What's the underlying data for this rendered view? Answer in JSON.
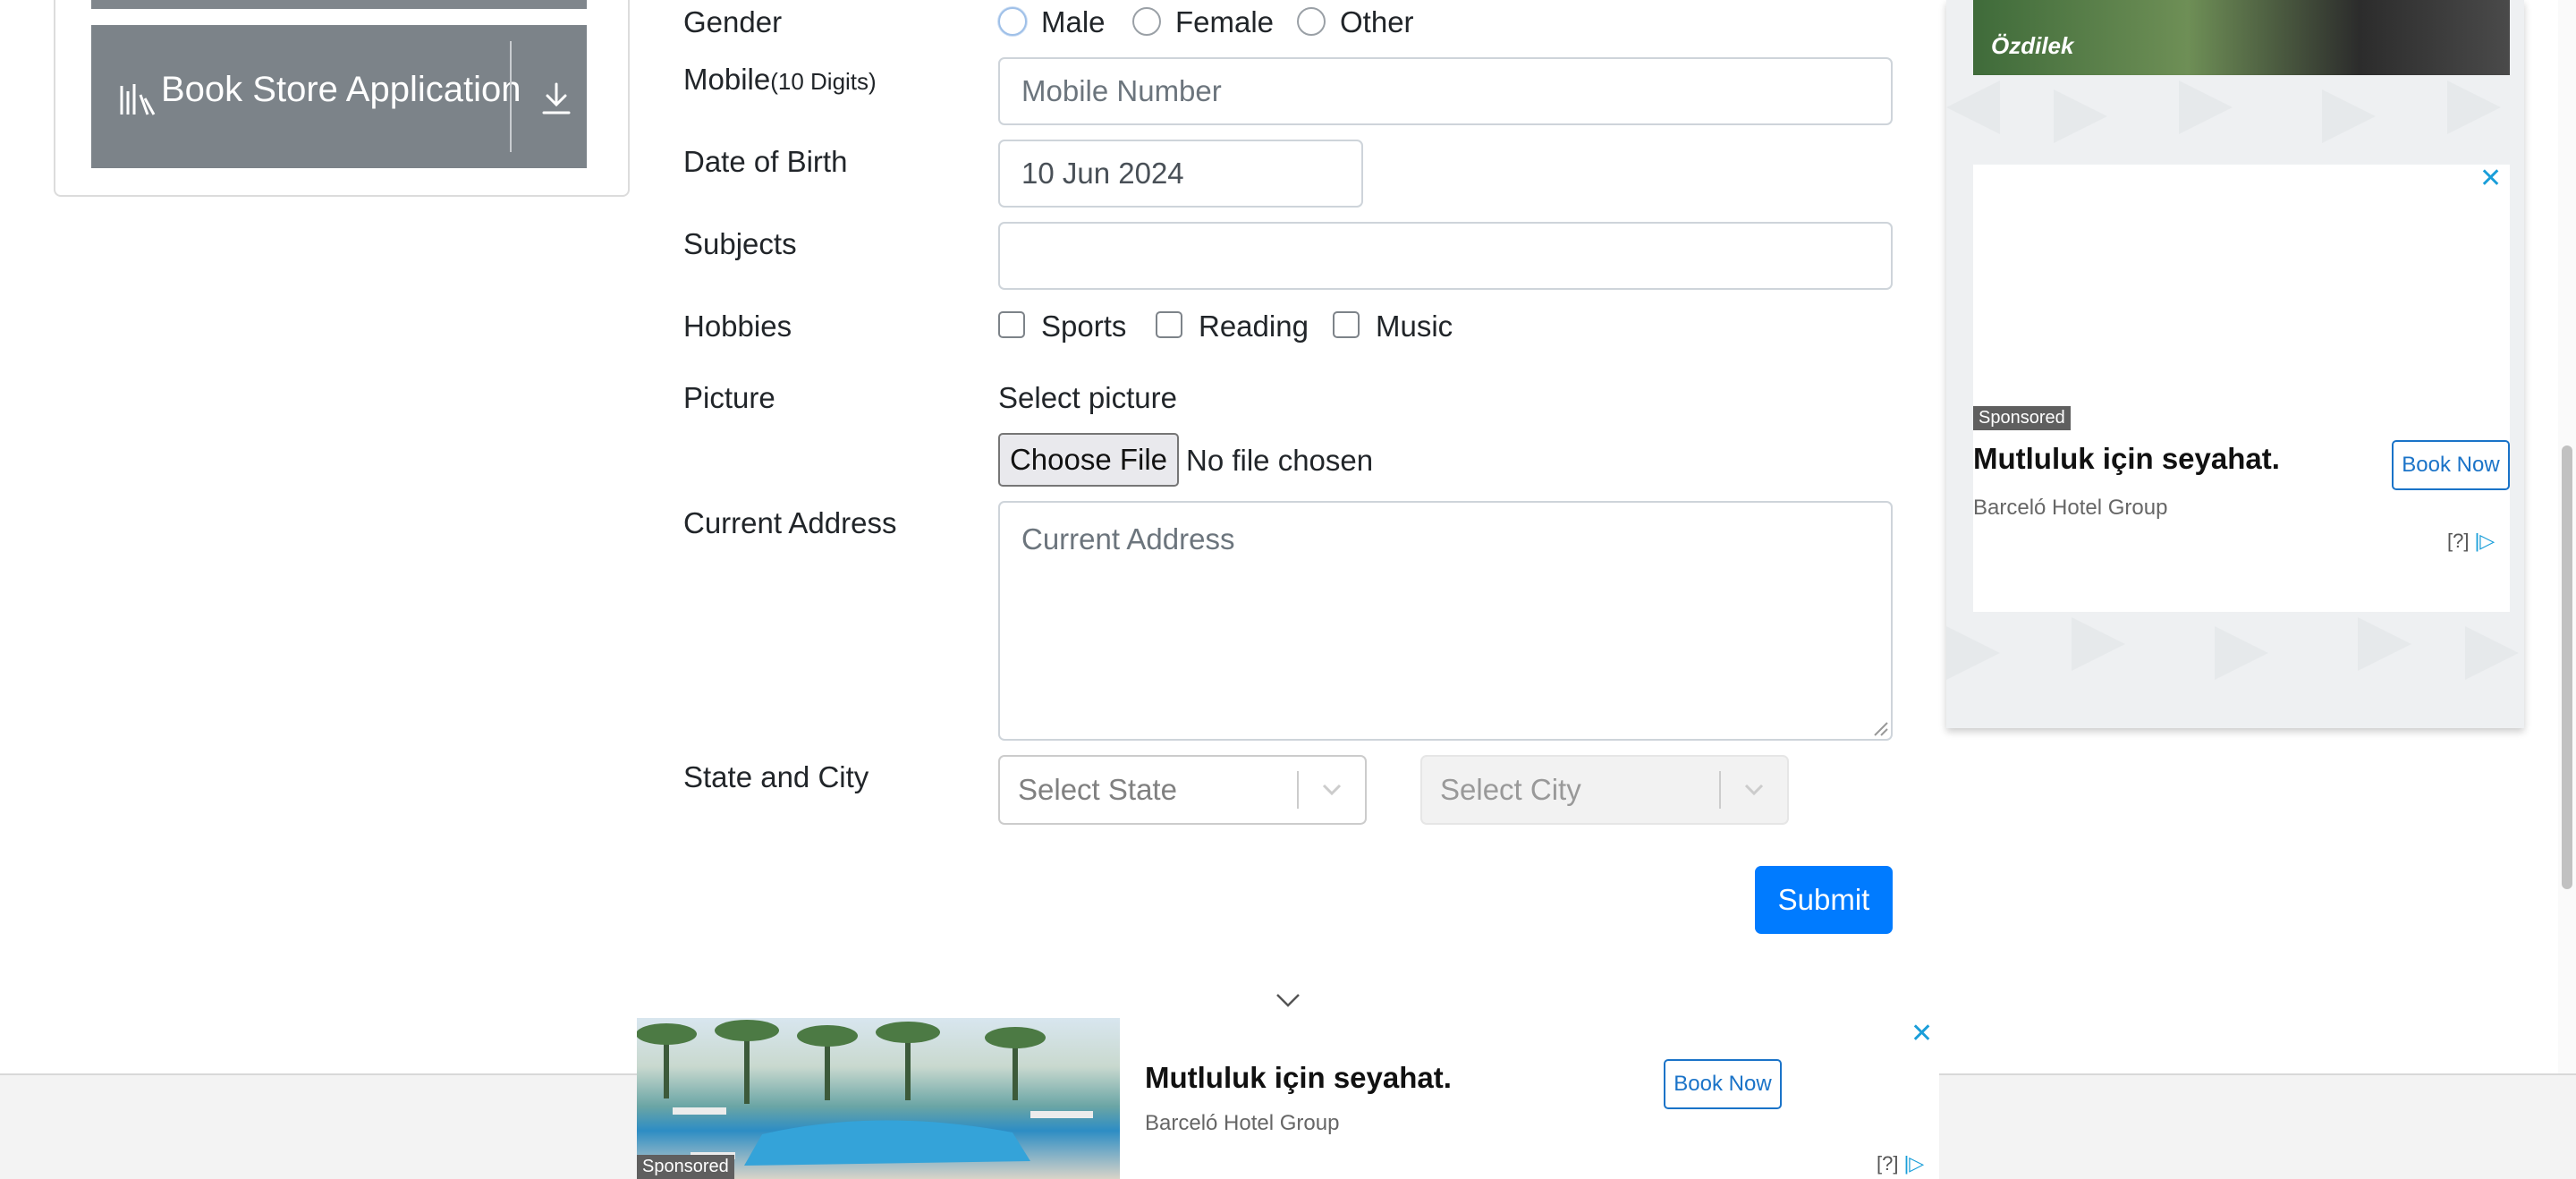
{
  "sidebar": {
    "app_tile": {
      "label": "Book Store Application",
      "icon": "books-icon",
      "action_icon": "download-icon"
    }
  },
  "form": {
    "gender": {
      "label": "Gender",
      "options": [
        "Male",
        "Female",
        "Other"
      ]
    },
    "mobile": {
      "label": "Mobile",
      "hint": "(10 Digits)",
      "placeholder": "Mobile Number"
    },
    "dob": {
      "label": "Date of Birth",
      "value": "10 Jun 2024"
    },
    "subjects": {
      "label": "Subjects",
      "value": ""
    },
    "hobbies": {
      "label": "Hobbies",
      "options": [
        "Sports",
        "Reading",
        "Music"
      ]
    },
    "picture": {
      "label": "Picture",
      "caption": "Select picture",
      "button": "Choose File",
      "status": "No file chosen"
    },
    "address": {
      "label": "Current Address",
      "placeholder": "Current Address"
    },
    "state_city": {
      "label": "State and City",
      "state_placeholder": "Select State",
      "city_placeholder": "Select City"
    },
    "submit_label": "Submit"
  },
  "side_ad": {
    "image_brand": "Özdilek",
    "sponsored": "Sponsored",
    "title": "Mutluluk için seyahat.",
    "source": "Barceló Hotel Group",
    "cta": "Book Now",
    "adchoices": "[?]",
    "close": "✕"
  },
  "bottom_ad": {
    "sponsored": "Sponsored",
    "title": "Mutluluk için seyahat.",
    "source": "Barceló Hotel Group",
    "cta": "Book Now",
    "adchoices": "[?]",
    "close": "✕"
  },
  "colors": {
    "primary": "#007bff",
    "tile_bg": "#7c8389",
    "ad_accent": "#1a9ed9"
  }
}
